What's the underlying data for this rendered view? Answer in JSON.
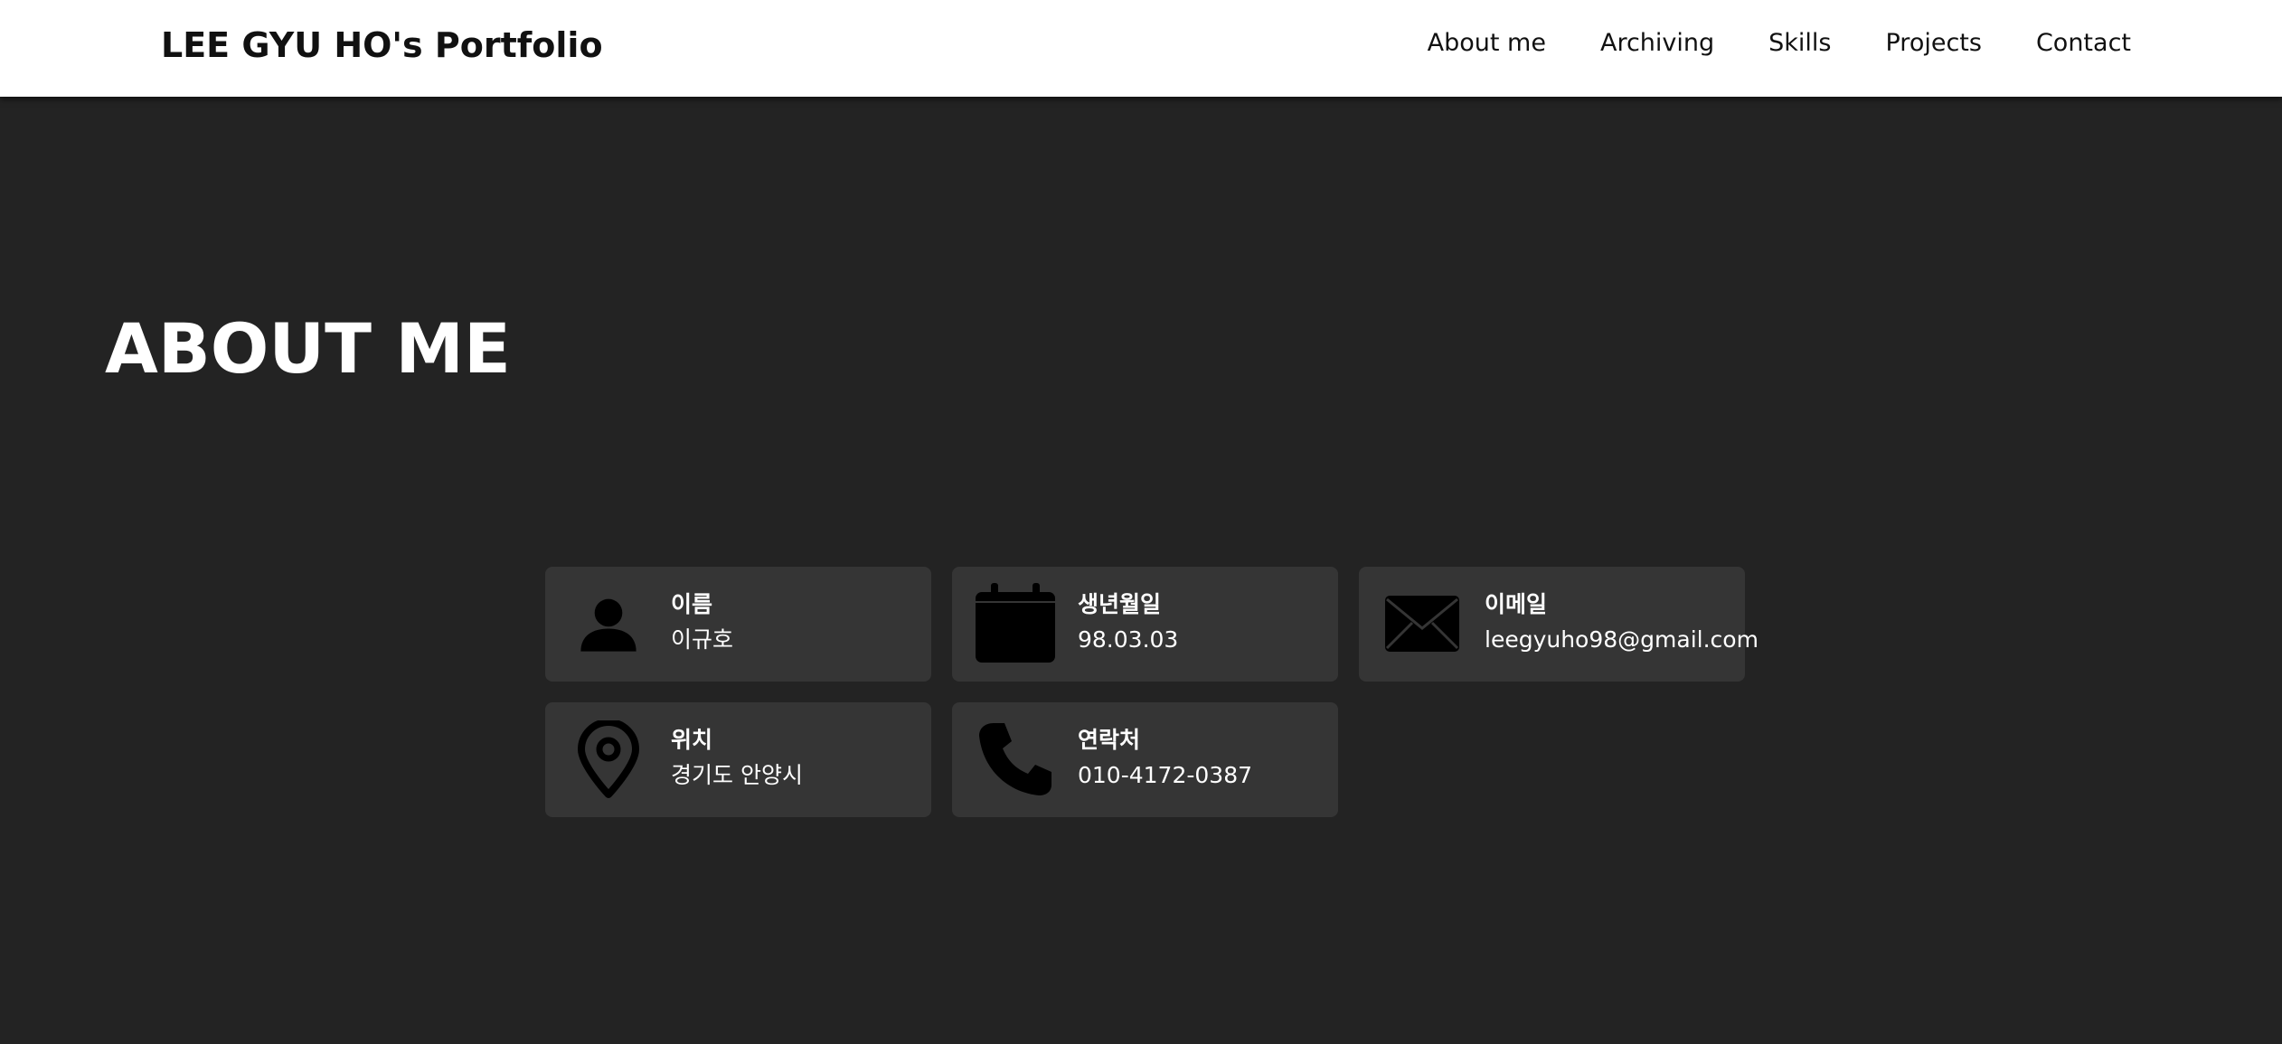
{
  "header": {
    "brand": "LEE GYU HO's Portfolio",
    "nav": [
      "About me",
      "Archiving",
      "Skills",
      "Projects",
      "Contact"
    ]
  },
  "section": {
    "title": "ABOUT ME"
  },
  "cards": [
    {
      "icon": "person-icon",
      "label": "이름",
      "value": "이규호"
    },
    {
      "icon": "calendar-icon",
      "label": "생년월일",
      "value": "98.03.03"
    },
    {
      "icon": "envelope-icon",
      "label": "이메일",
      "value": "leegyuho98@gmail.com"
    },
    {
      "icon": "location-pin-icon",
      "label": "위치",
      "value": "경기도 안양시"
    },
    {
      "icon": "phone-icon",
      "label": "연락처",
      "value": "010-4172-0387"
    }
  ],
  "colors": {
    "page_background": "#232323",
    "header_background": "#ffffff",
    "card_background": "#353535",
    "icon_color": "#000000",
    "text_light": "#ffffff",
    "text_dark": "#111111"
  }
}
